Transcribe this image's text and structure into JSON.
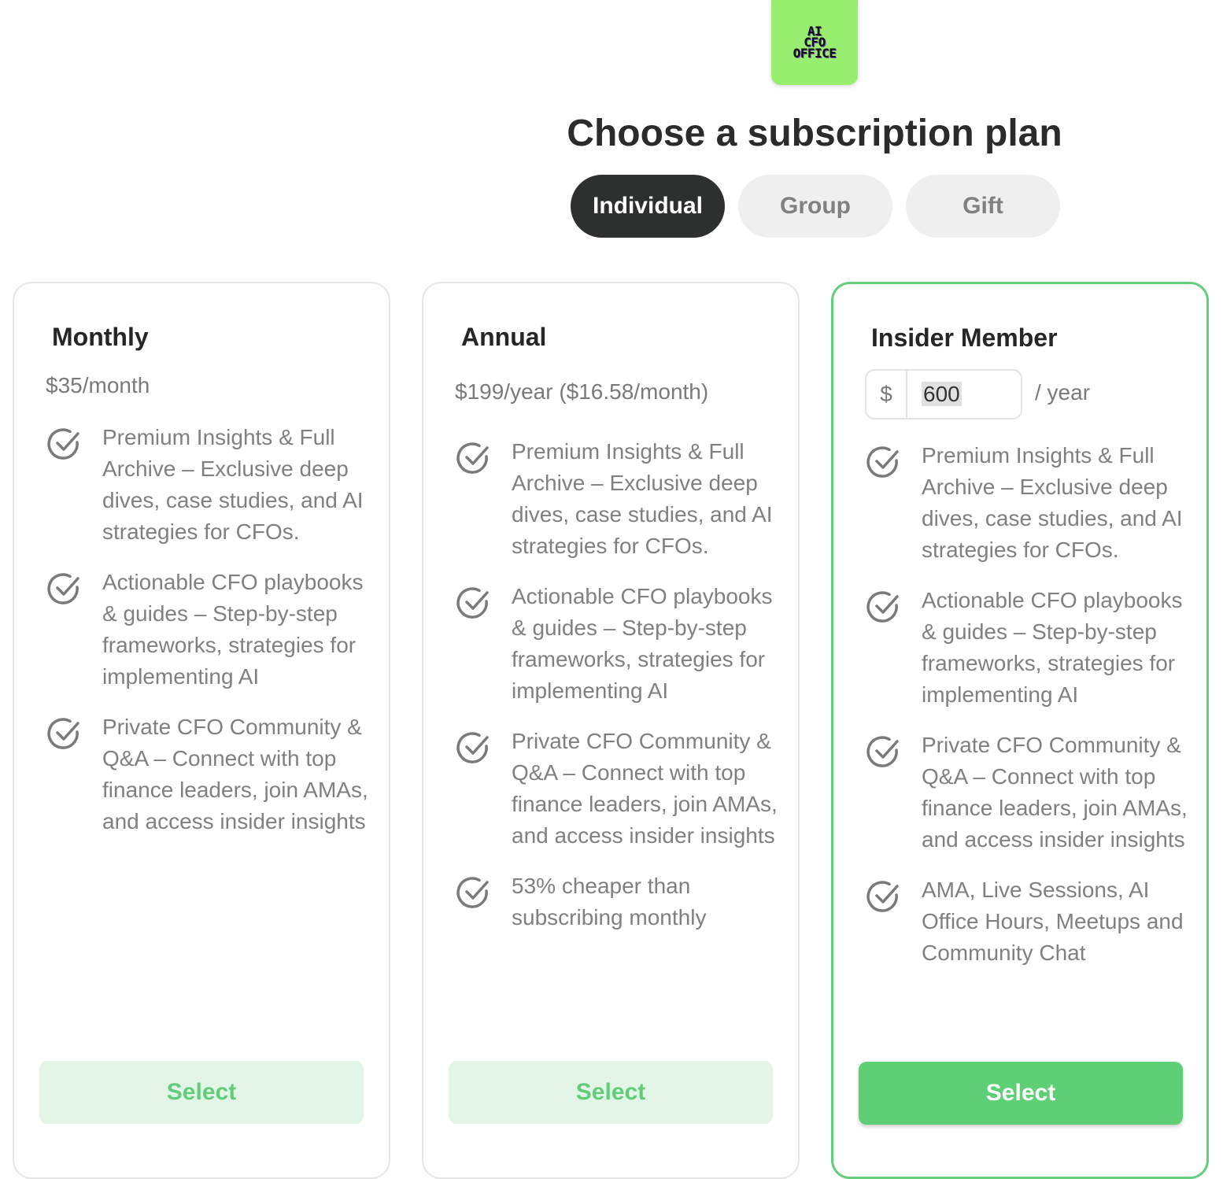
{
  "logo": {
    "lines": [
      "AI",
      "CFO",
      "OFFICE"
    ]
  },
  "header": {
    "title": "Choose a subscription plan"
  },
  "tabs": [
    {
      "label": "Individual",
      "active": true
    },
    {
      "label": "Group",
      "active": false
    },
    {
      "label": "Gift",
      "active": false
    }
  ],
  "plans": [
    {
      "title": "Monthly",
      "price": "$35/month",
      "features": [
        "Premium Insights & Full Archive – Exclusive deep dives, case studies, and AI strategies for CFOs.",
        "Actionable CFO playbooks & guides – Step-by-step frameworks, strategies for implementing AI",
        "Private CFO Community & Q&A – Connect with top finance leaders, join AMAs, and access insider insights"
      ],
      "select_label": "Select"
    },
    {
      "title": "Annual",
      "price": "$199/year ($16.58/month)",
      "features": [
        "Premium Insights & Full Archive – Exclusive deep dives, case studies, and AI strategies for CFOs.",
        "Actionable CFO playbooks & guides – Step-by-step frameworks, strategies for implementing AI",
        "Private CFO Community & Q&A – Connect with top finance leaders, join AMAs, and access insider insights",
        "53% cheaper than subscribing monthly"
      ],
      "select_label": "Select"
    },
    {
      "title": "Insider Member",
      "currency": "$",
      "amount": "600",
      "period": "/ year",
      "features": [
        "Premium Insights & Full Archive – Exclusive deep dives, case studies, and AI strategies for CFOs.",
        "Actionable CFO playbooks & guides – Step-by-step frameworks, strategies for implementing AI",
        "Private CFO Community & Q&A – Connect with top finance leaders, join AMAs, and access insider insights",
        "AMA, Live Sessions, AI Office Hours, Meetups and Community Chat"
      ],
      "select_label": "Select"
    }
  ],
  "colors": {
    "accent": "#5fcf75",
    "accent_light": "#e2f5e6",
    "active_tab": "#2e2f2f",
    "logo_bg": "#98ee6e"
  },
  "icons": {
    "feature": "check-circle-icon"
  }
}
